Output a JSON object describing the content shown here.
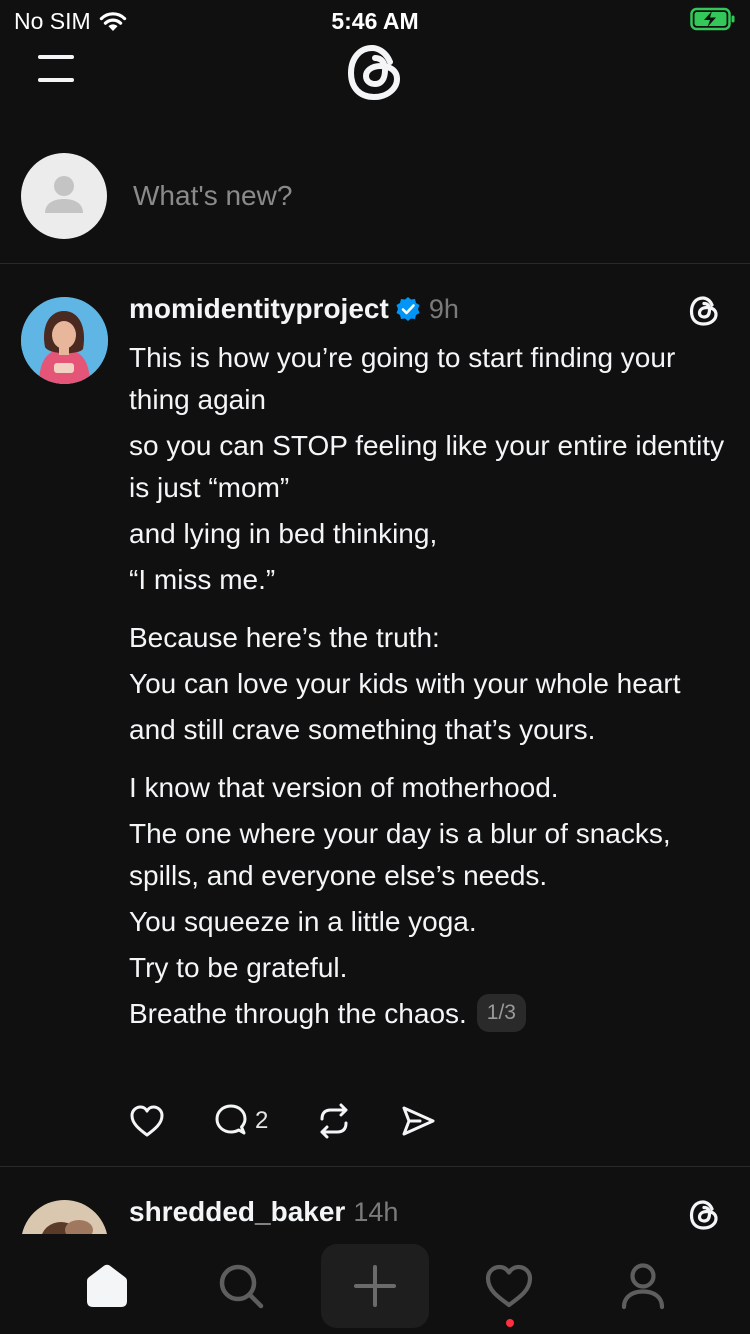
{
  "status_bar": {
    "carrier": "No SIM",
    "time": "5:46 AM"
  },
  "composer": {
    "placeholder": "What's new?"
  },
  "post": {
    "username": "momidentityproject",
    "time": "9h",
    "paragraphs": [
      "This is how you’re going to start finding your thing again",
      "so you can STOP feeling like your entire identity is just “mom”",
      "and lying in bed thinking,",
      "“I miss me.”",
      "Because here’s the truth:",
      "You can love your kids with your whole heart",
      "and still crave something that’s yours.",
      "I know that version of motherhood.",
      "The one where your day is a blur of snacks, spills, and everyone else’s needs.",
      "You squeeze in a little yoga.",
      "Try to be grateful.",
      "Breathe through the chaos."
    ],
    "page_indicator": "1/3",
    "reply_count": "2"
  },
  "next_post": {
    "username": "shredded_baker",
    "time": "14h"
  },
  "icons": {
    "wifi": "wifi-icon",
    "battery": "battery-charging-icon",
    "menu": "menu-icon",
    "logo": "threads-logo-icon",
    "verified": "verified-badge-icon",
    "like": "heart-icon",
    "reply": "comment-icon",
    "repost": "repost-icon",
    "share": "send-icon",
    "tabs": [
      "home-icon",
      "search-icon",
      "plus-icon",
      "heart-icon",
      "profile-icon"
    ]
  },
  "colors": {
    "background": "#101010",
    "text": "#f3f5f7",
    "muted": "#7a7a7a",
    "verified": "#0095f6",
    "battery": "#34c759",
    "notification_dot": "#ff3040"
  }
}
